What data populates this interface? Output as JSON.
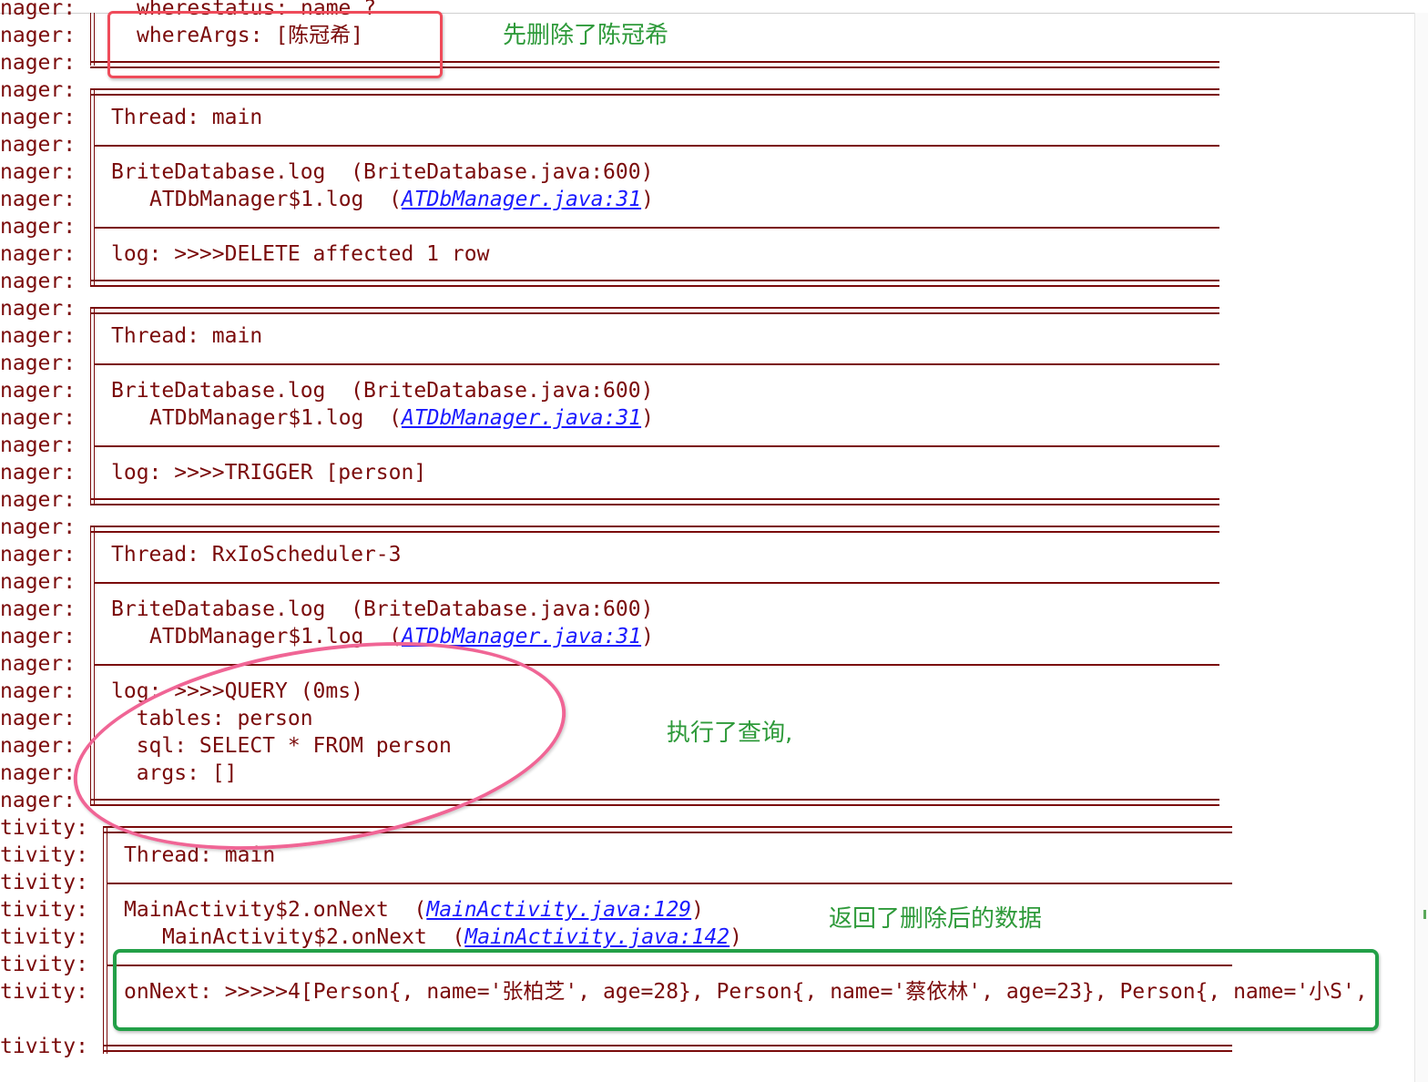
{
  "log_prefix": {
    "manager": "nager:",
    "activity": "tivity:"
  },
  "top_partial": "wherestatus: name ?",
  "where_args": "whereArgs: [陈冠希]",
  "blocks": [
    {
      "thread": "Thread: main",
      "trace1_method": "BriteDatabase.log  ",
      "trace1_loc": "(BriteDatabase.java:600)",
      "trace2_method": "ATDbManager$1.log  ",
      "trace2_link": "ATDbManager.java:31",
      "log_line": "log: >>>>DELETE affected 1 row"
    },
    {
      "thread": "Thread: main",
      "trace1_method": "BriteDatabase.log  ",
      "trace1_loc": "(BriteDatabase.java:600)",
      "trace2_method": "ATDbManager$1.log  ",
      "trace2_link": "ATDbManager.java:31",
      "log_line": "log: >>>>TRIGGER [person]"
    },
    {
      "thread": "Thread: RxIoScheduler-3",
      "trace1_method": "BriteDatabase.log  ",
      "trace1_loc": "(BriteDatabase.java:600)",
      "trace2_method": "ATDbManager$1.log  ",
      "trace2_link": "ATDbManager.java:31",
      "query_lines": [
        "log: >>>>QUERY (0ms)",
        "  tables: person",
        "  sql: SELECT * FROM person",
        "  args: []"
      ]
    },
    {
      "thread": "Thread: main",
      "trace1_method": "MainActivity$2.onNext  ",
      "trace1_link": "MainActivity.java:129",
      "trace2_method": "MainActivity$2.onNext  ",
      "trace2_link": "MainActivity.java:142",
      "log_line": "onNext: >>>>>4[Person{, name='张柏芝', age=28}, Person{, name='蔡依林', age=23}, Person{, name='小S',"
    }
  ],
  "annotations": {
    "delete_note": "先删除了陈冠希",
    "query_note": "执行了查询,",
    "result_note": "返回了删除后的数据"
  },
  "colors": {
    "log_text": "#7a0a0a",
    "link": "#1a1aff",
    "note_green": "#2e9a3a",
    "red_box": "#ef4b5a",
    "green_box": "#23a048",
    "pink_ellipse": "#f06595"
  }
}
